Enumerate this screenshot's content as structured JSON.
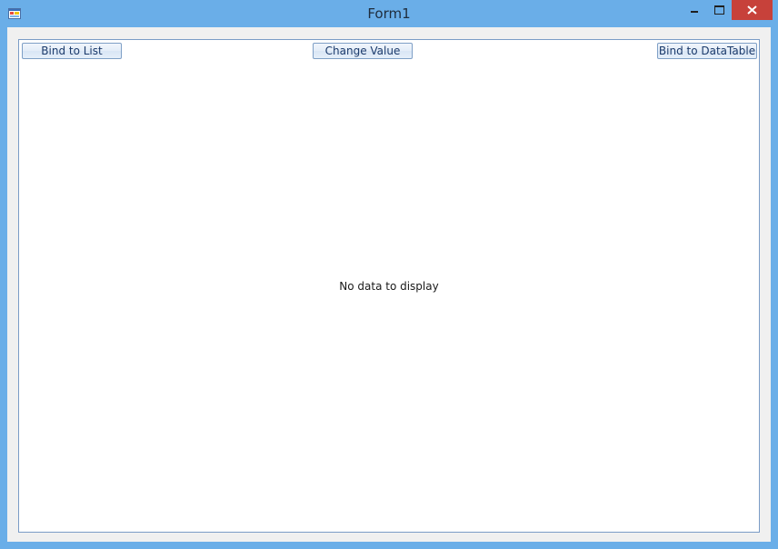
{
  "window": {
    "title": "Form1",
    "icon": "app-form-icon"
  },
  "toolbar": {
    "bind_list_label": "Bind to List",
    "change_value_label": "Change Value",
    "bind_datatable_label": "Bind to DataTable"
  },
  "grid": {
    "empty_message": "No data to display"
  },
  "colors": {
    "titlebar": "#6aaee8",
    "close_button": "#c7413a",
    "panel_border": "#7a9cc6",
    "button_text": "#1b3a6b"
  }
}
